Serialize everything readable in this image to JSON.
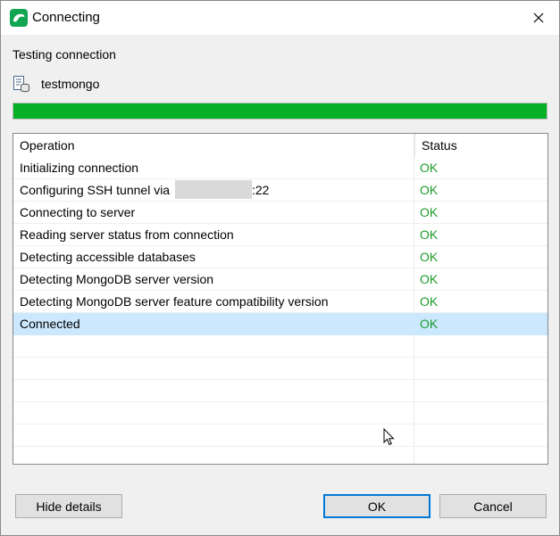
{
  "window": {
    "title": "Connecting"
  },
  "heading": "Testing connection",
  "connection": {
    "name": "testmongo"
  },
  "progress": {
    "value": 1.0
  },
  "table": {
    "columns": [
      "Operation",
      "Status"
    ],
    "rows": [
      {
        "operation": "Initializing connection",
        "status": "OK"
      },
      {
        "operation_prefix": "Configuring SSH tunnel via",
        "operation_suffix": ":22",
        "status": "OK"
      },
      {
        "operation": "Connecting to server",
        "status": "OK"
      },
      {
        "operation": "Reading server status from connection",
        "status": "OK"
      },
      {
        "operation": "Detecting accessible databases",
        "status": "OK"
      },
      {
        "operation": "Detecting MongoDB server version",
        "status": "OK"
      },
      {
        "operation": "Detecting MongoDB server feature compatibility version",
        "status": "OK"
      },
      {
        "operation": "Connected",
        "status": "OK",
        "selected": true
      }
    ]
  },
  "buttons": {
    "hide_details": "Hide details",
    "ok": "OK",
    "cancel": "Cancel"
  },
  "colors": {
    "progress": "#06b025",
    "status_ok": "#1c9c2a",
    "selection": "#cce8ff",
    "accent": "#0078d7",
    "app_icon": "#12a552"
  }
}
